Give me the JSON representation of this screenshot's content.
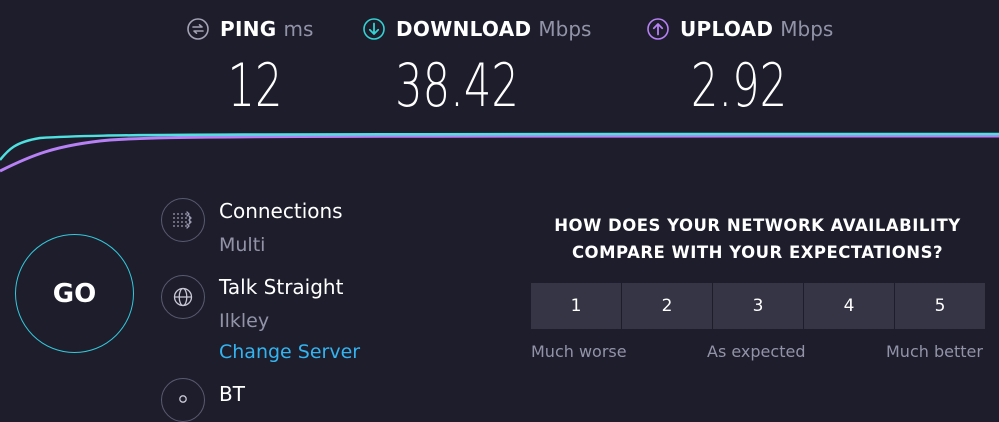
{
  "metrics": {
    "ping": {
      "name": "PING",
      "unit": "ms",
      "value": "12",
      "icon": "ping-icon",
      "color": "#a3a3b5"
    },
    "download": {
      "name": "DOWNLOAD",
      "unit": "Mbps",
      "value": "38.42",
      "icon": "download-arrow-icon",
      "color": "#33d3d3"
    },
    "upload": {
      "name": "UPLOAD",
      "unit": "Mbps",
      "value": "2.92",
      "icon": "upload-arrow-icon",
      "color": "#b780f5"
    }
  },
  "go_button": {
    "label": "GO",
    "color": "#33c9da"
  },
  "connections": {
    "title": "Connections",
    "value": "Multi",
    "icon": "connections-icon"
  },
  "server": {
    "title": "Talk Straight",
    "location": "Ilkley",
    "change_label": "Change Server",
    "icon": "globe-icon"
  },
  "provider": {
    "title": "BT",
    "icon": "person-icon"
  },
  "survey": {
    "question_line1": "HOW DOES YOUR NETWORK AVAILABILITY",
    "question_line2": "COMPARE WITH YOUR EXPECTATIONS?",
    "options": [
      "1",
      "2",
      "3",
      "4",
      "5"
    ],
    "label_low": "Much worse",
    "label_mid": "As expected",
    "label_high": "Much better"
  },
  "colors": {
    "background": "#1d1d2c",
    "download": "#33d3d3",
    "upload": "#b780f5",
    "link": "#33b4f0"
  }
}
